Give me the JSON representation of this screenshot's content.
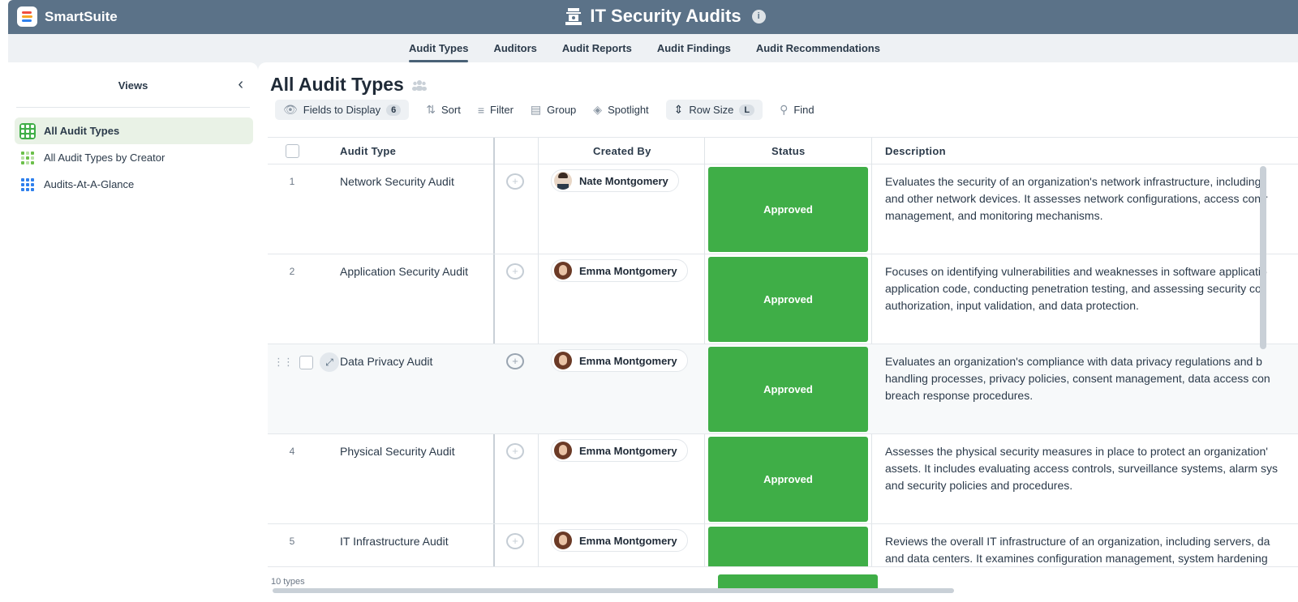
{
  "app": {
    "brand": "SmartSuite",
    "title": "IT Security Audits",
    "info_icon": "info-icon",
    "header_color": "#5b7288"
  },
  "tabs": [
    {
      "label": "Audit Types",
      "active": true
    },
    {
      "label": "Auditors",
      "active": false
    },
    {
      "label": "Audit Reports",
      "active": false
    },
    {
      "label": "Audit Findings",
      "active": false
    },
    {
      "label": "Audit Recommendations",
      "active": false
    }
  ],
  "sidebar": {
    "title": "Views",
    "collapse_icon": "chevron-left-icon",
    "items": [
      {
        "label": "All Audit Types",
        "active": true,
        "icon": "grid-view-icon"
      },
      {
        "label": "All Audit Types by Creator",
        "active": false,
        "icon": "grouped-grid-icon"
      },
      {
        "label": "Audits-At-A-Glance",
        "active": false,
        "icon": "card-grid-icon"
      }
    ]
  },
  "view": {
    "title": "All Audit Types",
    "shared_icon": "people-icon"
  },
  "toolbar": {
    "fields_label": "Fields to Display",
    "fields_count": "6",
    "sort_label": "Sort",
    "filter_label": "Filter",
    "group_label": "Group",
    "spotlight_label": "Spotlight",
    "row_size_label": "Row Size",
    "row_size_value": "L",
    "find_label": "Find"
  },
  "columns": {
    "audit_type": "Audit Type",
    "created_by": "Created By",
    "status": "Status",
    "description": "Description"
  },
  "rows": [
    {
      "num": "1",
      "title": "Network Security Audit",
      "creator": "Nate Montgomery",
      "status": "Approved",
      "desc1": "Evaluates the security of an organization's network infrastructure, including",
      "desc2": "and other network devices. It assesses network configurations, access contr",
      "desc3": "management, and monitoring mechanisms."
    },
    {
      "num": "2",
      "title": "Application Security Audit",
      "creator": "Emma Montgomery",
      "status": "Approved",
      "desc1": "Focuses on identifying vulnerabilities and weaknesses in software applicatio",
      "desc2": "application code, conducting penetration testing, and assessing security co",
      "desc3": "authorization, input validation, and data protection."
    },
    {
      "num": "",
      "title": "Data Privacy Audit",
      "creator": "Emma Montgomery",
      "status": "Approved",
      "desc1": "Evaluates an organization's compliance with data privacy regulations and b",
      "desc2": "handling processes, privacy policies, consent management, data access con",
      "desc3": "breach response procedures."
    },
    {
      "num": "4",
      "title": "Physical Security Audit",
      "creator": "Emma Montgomery",
      "status": "Approved",
      "desc1": "Assesses the physical security measures in place to protect an organization'",
      "desc2": "assets. It includes evaluating access controls, surveillance systems, alarm sys",
      "desc3": "and security policies and procedures."
    },
    {
      "num": "5",
      "title": "IT Infrastructure Audit",
      "creator": "Emma Montgomery",
      "status": "",
      "desc1": "Reviews the overall IT infrastructure of an organization, including servers, da",
      "desc2": "and data centers. It examines configuration management, system hardening",
      "desc3": ""
    }
  ],
  "footer": {
    "count": "10 types"
  },
  "colors": {
    "approved": "#3fae47",
    "active_view_bg": "#e9f2e6"
  }
}
